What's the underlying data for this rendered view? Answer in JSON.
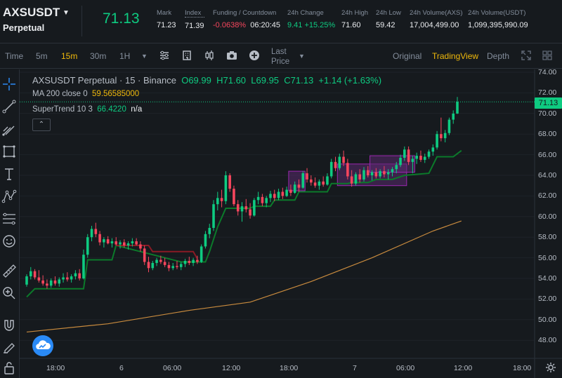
{
  "header": {
    "symbol": "AXSUSDT",
    "contract": "Perpetual",
    "last_price": "71.13",
    "stats": [
      {
        "label": "Mark",
        "value": "71.23"
      },
      {
        "label": "Index",
        "value": "71.39"
      },
      {
        "label": "Funding / Countdown",
        "value": "-0.0638%",
        "value2": "06:20:45"
      },
      {
        "label": "24h Change",
        "value": "9.41 +15.25%"
      },
      {
        "label": "24h High",
        "value": "71.60"
      },
      {
        "label": "24h Low",
        "value": "59.42"
      },
      {
        "label": "24h Volume(AXS)",
        "value": "17,004,499.00"
      },
      {
        "label": "24h Volume(USDT)",
        "value": "1,099,395,990.09"
      }
    ]
  },
  "toolbar": {
    "time_label": "Time",
    "intervals": [
      "5m",
      "15m",
      "30m",
      "1H"
    ],
    "active_interval": "15m",
    "last_price_label": "Last Price",
    "views": [
      "Original",
      "TradingView",
      "Depth"
    ],
    "active_view": "TradingView"
  },
  "legend": {
    "title": "AXSUSDT Perpetual · 15 · Binance",
    "o": "O69.99",
    "h": "H71.60",
    "l": "L69.95",
    "c": "C71.13",
    "chg": "+1.14 (+1.63%)",
    "ma_label": "MA 200 close 0",
    "ma_value": "59.56585000",
    "st_label": "SuperTrend 10 3",
    "st_value": "66.4220",
    "st_na": "n/a",
    "collapse_glyph": "⌃"
  },
  "price_tag": "71.13",
  "colors": {
    "up": "#0ecb81",
    "down": "#f6465d",
    "ma": "#c98b3e",
    "supertrend_up": "#0b7a2a",
    "supertrend_down": "#8a1a25",
    "box_fill": "#5a2a6e",
    "box_stroke": "#9c27b0",
    "accent": "#f0b90b"
  },
  "chart_data": {
    "type": "candlestick",
    "y_axis_labels": [
      "74.00",
      "72.00",
      "70.00",
      "68.00",
      "66.00",
      "64.00",
      "62.00",
      "60.00",
      "58.00",
      "56.00",
      "54.00",
      "52.00",
      "50.00",
      "48.00"
    ],
    "ylim": [
      46.5,
      74.6
    ],
    "x_axis_labels": [
      "18:00",
      "6",
      "06:00",
      "12:00",
      "18:00",
      "7",
      "06:00",
      "12:00",
      "18:00"
    ],
    "candles": [
      [
        53.4,
        54.4,
        53.2,
        54.2
      ],
      [
        54.2,
        55.1,
        53.9,
        54.7
      ],
      [
        54.7,
        54.9,
        53.9,
        54.1
      ],
      [
        54.1,
        54.8,
        53.6,
        53.8
      ],
      [
        53.8,
        54.3,
        53.3,
        53.5
      ],
      [
        53.5,
        53.9,
        53.0,
        53.3
      ],
      [
        53.3,
        54.0,
        53.1,
        53.8
      ],
      [
        53.8,
        54.2,
        53.3,
        53.5
      ],
      [
        53.5,
        54.1,
        53.2,
        53.9
      ],
      [
        53.9,
        54.5,
        53.6,
        54.1
      ],
      [
        54.1,
        54.6,
        53.7,
        53.9
      ],
      [
        53.9,
        54.4,
        53.6,
        54.2
      ],
      [
        54.2,
        54.8,
        53.9,
        54.5
      ],
      [
        54.5,
        54.9,
        53.8,
        54.0
      ],
      [
        54.0,
        56.8,
        53.9,
        56.3
      ],
      [
        56.3,
        58.3,
        56.0,
        58.0
      ],
      [
        58.0,
        59.1,
        57.6,
        58.8
      ],
      [
        58.8,
        59.4,
        58.0,
        58.3
      ],
      [
        58.3,
        58.6,
        57.2,
        57.5
      ],
      [
        57.5,
        58.0,
        57.0,
        57.8
      ],
      [
        57.8,
        58.1,
        57.3,
        57.4
      ],
      [
        57.4,
        57.9,
        57.0,
        57.6
      ],
      [
        57.6,
        58.0,
        57.2,
        57.3
      ],
      [
        57.3,
        57.7,
        56.9,
        57.5
      ],
      [
        57.5,
        57.8,
        57.0,
        57.2
      ],
      [
        57.2,
        57.6,
        56.8,
        57.4
      ],
      [
        57.4,
        57.9,
        57.1,
        57.6
      ],
      [
        57.6,
        57.9,
        57.2,
        57.3
      ],
      [
        57.3,
        57.6,
        56.6,
        56.9
      ],
      [
        56.9,
        57.2,
        55.3,
        55.6
      ],
      [
        55.6,
        56.1,
        54.6,
        55.0
      ],
      [
        55.0,
        55.7,
        54.8,
        55.5
      ],
      [
        55.5,
        56.0,
        55.2,
        55.8
      ],
      [
        55.8,
        56.2,
        55.4,
        55.6
      ],
      [
        55.6,
        56.0,
        55.1,
        55.3
      ],
      [
        55.3,
        55.6,
        54.7,
        55.0
      ],
      [
        55.0,
        55.5,
        54.8,
        55.2
      ],
      [
        55.2,
        55.7,
        54.9,
        55.1
      ],
      [
        55.1,
        55.6,
        54.8,
        55.4
      ],
      [
        55.4,
        55.9,
        55.1,
        55.7
      ],
      [
        55.7,
        56.1,
        55.3,
        55.5
      ],
      [
        55.5,
        56.0,
        55.2,
        55.8
      ],
      [
        55.8,
        56.2,
        55.4,
        55.6
      ],
      [
        55.6,
        57.3,
        55.5,
        57.1
      ],
      [
        57.1,
        58.6,
        56.9,
        58.3
      ],
      [
        58.3,
        59.3,
        57.9,
        58.9
      ],
      [
        58.9,
        61.6,
        58.6,
        61.2
      ],
      [
        61.2,
        62.4,
        60.6,
        61.8
      ],
      [
        61.8,
        62.6,
        60.9,
        61.5
      ],
      [
        61.5,
        64.4,
        61.2,
        64.0
      ],
      [
        64.0,
        64.2,
        62.4,
        62.7
      ],
      [
        62.7,
        63.0,
        61.0,
        61.2
      ],
      [
        61.2,
        61.6,
        60.1,
        60.5
      ],
      [
        60.5,
        61.4,
        59.5,
        61.0
      ],
      [
        61.0,
        61.7,
        60.4,
        60.7
      ],
      [
        60.7,
        61.3,
        59.8,
        60.1
      ],
      [
        60.1,
        61.8,
        60.0,
        61.6
      ],
      [
        61.6,
        62.4,
        61.2,
        61.9
      ],
      [
        61.9,
        62.2,
        61.0,
        61.3
      ],
      [
        61.3,
        62.0,
        60.9,
        61.8
      ],
      [
        61.8,
        62.5,
        61.4,
        62.2
      ],
      [
        62.2,
        62.6,
        61.5,
        61.8
      ],
      [
        61.8,
        62.7,
        61.6,
        62.4
      ],
      [
        62.4,
        62.8,
        61.7,
        62.0
      ],
      [
        62.0,
        62.9,
        61.9,
        62.6
      ],
      [
        62.6,
        63.1,
        62.0,
        62.3
      ],
      [
        62.3,
        63.4,
        62.2,
        63.1
      ],
      [
        63.1,
        63.6,
        62.4,
        62.8
      ],
      [
        62.8,
        64.4,
        62.7,
        64.2
      ],
      [
        64.2,
        64.7,
        63.3,
        63.6
      ],
      [
        63.6,
        64.0,
        63.0,
        63.3
      ],
      [
        63.3,
        63.8,
        62.8,
        63.0
      ],
      [
        63.0,
        63.6,
        62.6,
        63.4
      ],
      [
        63.4,
        63.9,
        62.9,
        63.1
      ],
      [
        63.1,
        64.2,
        63.0,
        63.9
      ],
      [
        63.9,
        65.6,
        63.7,
        65.3
      ],
      [
        65.3,
        65.8,
        64.4,
        64.7
      ],
      [
        64.7,
        66.1,
        64.5,
        65.8
      ],
      [
        65.8,
        66.4,
        64.9,
        65.2
      ],
      [
        65.2,
        65.6,
        63.6,
        63.9
      ],
      [
        63.9,
        64.5,
        62.9,
        63.2
      ],
      [
        63.2,
        64.3,
        63.0,
        64.1
      ],
      [
        64.1,
        64.6,
        63.3,
        63.6
      ],
      [
        63.6,
        64.8,
        63.4,
        64.5
      ],
      [
        64.5,
        64.9,
        63.8,
        64.0
      ],
      [
        64.0,
        64.5,
        63.5,
        64.3
      ],
      [
        64.3,
        64.7,
        63.7,
        63.9
      ],
      [
        63.9,
        64.6,
        63.7,
        64.4
      ],
      [
        64.4,
        64.9,
        63.8,
        64.1
      ],
      [
        64.1,
        64.6,
        63.6,
        64.3
      ],
      [
        64.3,
        64.8,
        63.9,
        64.6
      ],
      [
        64.6,
        65.3,
        64.2,
        65.0
      ],
      [
        65.0,
        66.0,
        64.8,
        65.7
      ],
      [
        65.7,
        66.8,
        65.4,
        66.5
      ],
      [
        66.5,
        66.8,
        65.0,
        65.3
      ],
      [
        65.3,
        65.9,
        64.2,
        65.6
      ],
      [
        65.6,
        66.2,
        65.1,
        65.9
      ],
      [
        65.9,
        66.4,
        65.3,
        65.5
      ],
      [
        65.5,
        66.1,
        65.2,
        65.8
      ],
      [
        65.8,
        66.5,
        65.6,
        66.3
      ],
      [
        66.3,
        67.0,
        65.9,
        66.7
      ],
      [
        66.7,
        68.3,
        66.5,
        68.0
      ],
      [
        68.0,
        69.6,
        67.3,
        67.6
      ],
      [
        67.6,
        68.4,
        67.2,
        68.1
      ],
      [
        68.1,
        69.6,
        67.9,
        69.4
      ],
      [
        69.4,
        70.3,
        69.0,
        69.99
      ],
      [
        69.99,
        71.6,
        69.95,
        71.13
      ]
    ],
    "supertrend": [
      [
        0,
        52.2
      ],
      [
        2,
        53.0
      ],
      [
        14,
        53.0
      ],
      [
        15,
        55.8
      ],
      [
        21,
        55.8
      ],
      [
        22,
        57.2
      ],
      [
        38,
        55.6
      ],
      [
        40,
        55.6
      ],
      [
        42,
        55.6
      ],
      [
        43,
        55.6
      ],
      [
        44,
        55.6
      ],
      [
        45,
        56.6
      ],
      [
        47,
        59.0
      ],
      [
        49,
        60.8
      ],
      [
        55,
        60.8
      ],
      [
        56,
        61.0
      ],
      [
        60,
        61.0
      ],
      [
        61,
        61.6
      ],
      [
        66,
        61.6
      ],
      [
        67,
        62.4
      ],
      [
        74,
        62.4
      ],
      [
        75,
        63.2
      ],
      [
        79,
        63.2
      ],
      [
        80,
        63.3
      ],
      [
        84,
        63.3
      ],
      [
        86,
        63.6
      ],
      [
        90,
        63.6
      ],
      [
        93,
        64.0
      ],
      [
        99,
        64.2
      ],
      [
        101,
        65.8
      ],
      [
        105,
        65.8
      ],
      [
        107,
        66.4
      ]
    ],
    "ma200": [
      [
        0,
        48.8
      ],
      [
        20,
        49.6
      ],
      [
        40,
        50.9
      ],
      [
        55,
        51.7
      ],
      [
        70,
        53.7
      ],
      [
        85,
        56.0
      ],
      [
        100,
        58.6
      ],
      [
        107,
        59.57
      ]
    ],
    "boxes": [
      [
        68,
        65,
        62.5,
        64.4
      ],
      [
        77,
        93,
        63.0,
        65.1
      ],
      [
        85,
        95,
        64.3,
        65.9
      ]
    ]
  }
}
